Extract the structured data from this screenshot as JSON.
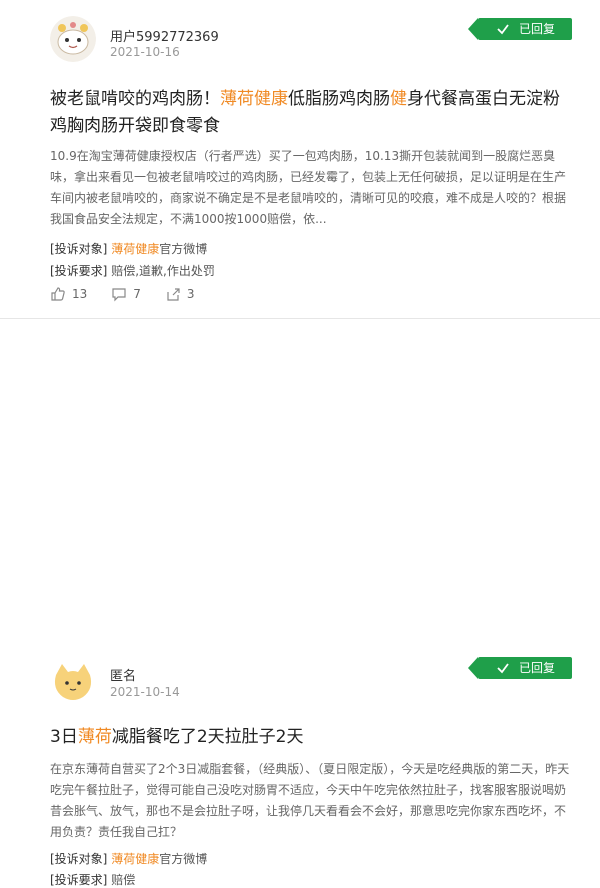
{
  "complaints": [
    {
      "user": "用户5992772369",
      "date": "2021-10-16",
      "badge": "已回复",
      "title_parts": [
        "被老鼠啃咬的鸡肉肠！",
        "薄荷健康",
        "低脂肠鸡肉肠",
        "健",
        "身代餐高蛋白无淀粉鸡胸肉肠开袋即食零食"
      ],
      "desc": "10.9在淘宝薄荷健康授权店（行者严选）买了一包鸡肉肠，10.13撕开包装就闻到一股腐烂恶臭味，拿出来看见一包被老鼠啃咬过的鸡肉肠，已经发霉了，包装上无任何破损，足以证明是在生产车间内被老鼠啃咬的，商家说不确定是不是老鼠啃咬的，清晰可见的咬痕，难不成是人咬的？根据我国食品安全法规定，不满1000按1000赔偿，依...",
      "target_key": "[投诉对象]",
      "target_name": "薄荷健康",
      "target_suffix": "官方微博",
      "request_key": "[投诉要求]",
      "request_val": "赔偿,道歉,作出处罚",
      "likes": "13",
      "comments": "7",
      "shares": "3"
    },
    {
      "user": "匿名",
      "date": "2021-10-14",
      "badge": "已回复",
      "title_parts": [
        "3日",
        "薄荷",
        "减脂餐吃了2天拉肚子2天"
      ],
      "desc": "在京东薄荷自营买了2个3日减脂套餐，（经典版）、（夏日限定版），今天是吃经典版的第二天，昨天吃完午餐拉肚子，觉得可能自己没吃对肠胃不适应，今天中午吃完依然拉肚子，找客服客服说喝奶昔会胀气、放气，那也不是会拉肚子呀，让我停几天看看会不会好，那意思吃完你家东西吃坏，不用负责？责任我自己扛？",
      "target_key": "[投诉对象]",
      "target_name": "薄荷健康",
      "target_suffix": "官方微博",
      "request_key": "[投诉要求]",
      "request_val": "赔偿"
    }
  ]
}
